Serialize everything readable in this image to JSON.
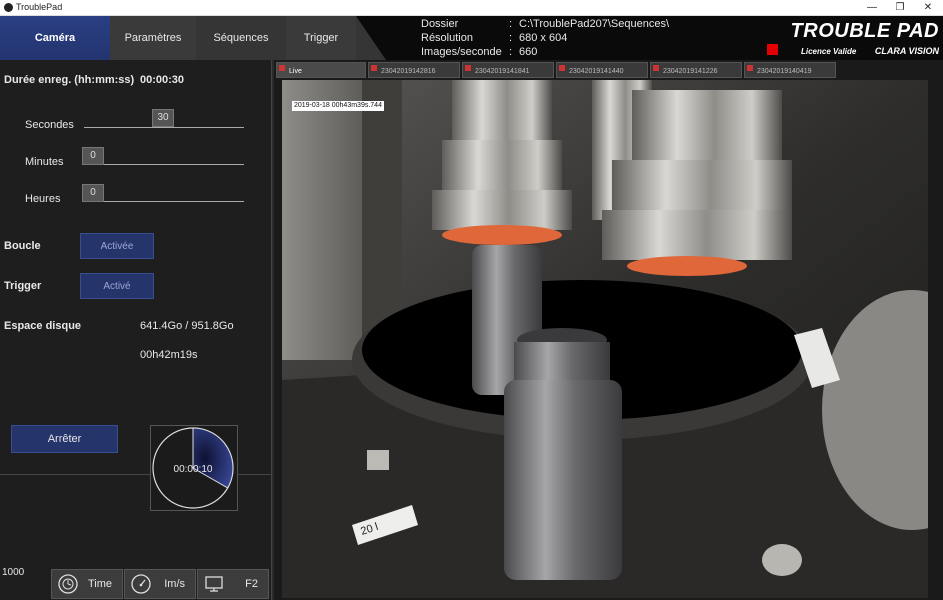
{
  "window": {
    "title": "TroublePad"
  },
  "tabs": [
    "Caméra",
    "Paramètres",
    "Séquences",
    "Trigger"
  ],
  "info": {
    "rows": [
      {
        "label": "Dossier",
        "value": "C:\\TroublePad207\\Sequences\\"
      },
      {
        "label": "Résolution",
        "value": "680 x 604"
      },
      {
        "label": "Images/seconde",
        "value": "660"
      }
    ]
  },
  "brand": {
    "title": "TROUBLE PAD",
    "license": "Licence Valide",
    "company": "CLARA VISION"
  },
  "left": {
    "duration_label": "Durée enreg. (hh:mm:ss)",
    "duration_value": "00:00:30",
    "sliders": [
      {
        "label": "Secondes",
        "value": "30"
      },
      {
        "label": "Minutes",
        "value": "0"
      },
      {
        "label": "Heures",
        "value": "0"
      }
    ],
    "loop_label": "Boucle",
    "loop_btn": "Activée",
    "trigger_label": "Trigger",
    "trigger_btn": "Activé",
    "disk_label": "Espace disque",
    "disk_value": "641.4Go / 951.8Go",
    "disk_time": "00h42m19s",
    "stop_btn": "Arrêter",
    "timer_value": "00:00:10",
    "timer_fraction": 0.333
  },
  "statusbar": {
    "count": "1000",
    "buttons": [
      {
        "label": "Time",
        "icon": "clock-icon"
      },
      {
        "label": "Im/s",
        "icon": "speedometer-icon"
      },
      {
        "label": "F2",
        "icon": "monitor-icon"
      }
    ]
  },
  "video": {
    "tabs": [
      "Live",
      "23042019142816",
      "23042019141841",
      "23042019141440",
      "23042019141226",
      "23042019140419"
    ],
    "timestamp": "2019-03-18 00h43m39s.744",
    "label_text": "20 l"
  },
  "colors": {
    "accent": "#25346a",
    "tab_active": "#2a3f82",
    "brand_red": "#e40000"
  }
}
